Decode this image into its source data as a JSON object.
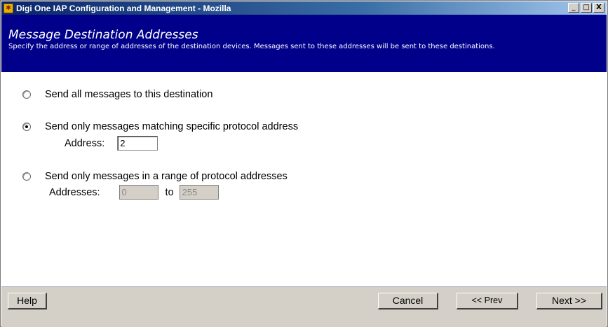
{
  "window": {
    "title": "Digi One IAP Configuration and Management - Mozilla",
    "app_icon": "digi-app-icon",
    "controls": {
      "minimize": "_",
      "maximize": "□",
      "close": "X"
    }
  },
  "header": {
    "title": "Message Destination Addresses",
    "description": "Specify the address or range of addresses of the destination devices. Messages sent to these addresses will be sent to these destinations."
  },
  "options": {
    "all": {
      "label": "Send all messages to this destination",
      "selected": false
    },
    "specific": {
      "label": "Send only messages matching specific protocol address",
      "selected": true,
      "address_label": "Address:",
      "address_value": "2"
    },
    "range": {
      "label": "Send only messages in a range of protocol addresses",
      "selected": false,
      "addresses_label": "Addresses:",
      "from_value": "0",
      "to_label": "to",
      "to_value": "255"
    }
  },
  "footer": {
    "help": "Help",
    "cancel": "Cancel",
    "prev": "<< Prev",
    "next": "Next >>"
  },
  "colors": {
    "header_bg": "#00008b",
    "titlebar_start": "#0a246a",
    "footer_bg": "#d4d0c8"
  }
}
